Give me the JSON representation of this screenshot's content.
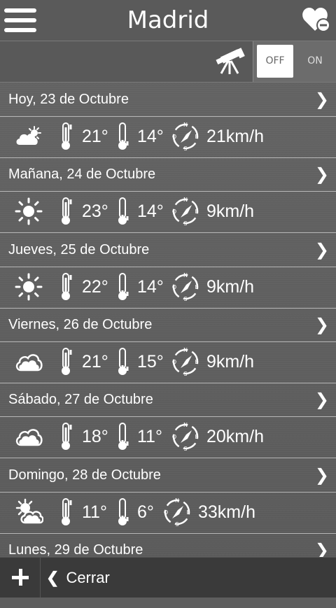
{
  "header": {
    "title": "Madrid"
  },
  "toolbar": {
    "toggle_off": "OFF",
    "toggle_on": "ON",
    "toggle_state": "OFF"
  },
  "days": [
    {
      "label": "Hoy, 23 de Octubre",
      "icon": "partly-sunny-icon",
      "max": "21°",
      "min": "14°",
      "wind": "21km/h"
    },
    {
      "label": "Mañana, 24 de Octubre",
      "icon": "sun-icon",
      "max": "23°",
      "min": "14°",
      "wind": "9km/h"
    },
    {
      "label": "Jueves, 25 de Octubre",
      "icon": "sun-icon",
      "max": "22°",
      "min": "14°",
      "wind": "9km/h"
    },
    {
      "label": "Viernes, 26 de Octubre",
      "icon": "cloud-icon",
      "max": "21°",
      "min": "15°",
      "wind": "9km/h"
    },
    {
      "label": "Sábado, 27 de Octubre",
      "icon": "cloud-icon",
      "max": "18°",
      "min": "11°",
      "wind": "20km/h"
    },
    {
      "label": "Domingo, 28 de Octubre",
      "icon": "sun-behind-cloud-icon",
      "max": "11°",
      "min": "6°",
      "wind": "33km/h"
    },
    {
      "label": "Lunes, 29 de Octubre"
    }
  ],
  "chevron": "❯",
  "footer": {
    "close_label": "Cerrar",
    "close_chevron": "❮"
  }
}
